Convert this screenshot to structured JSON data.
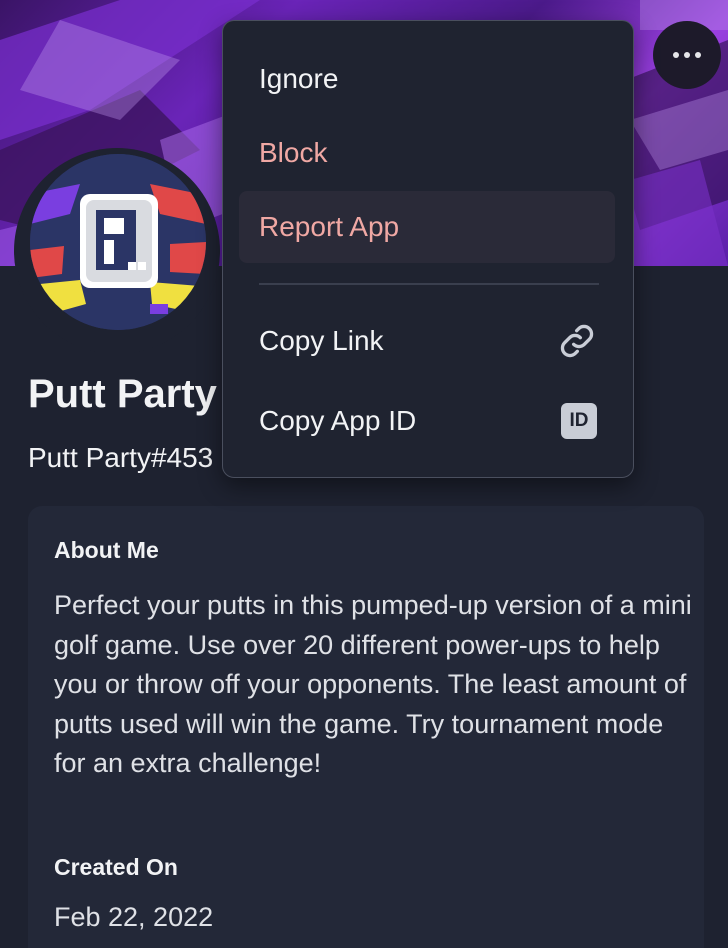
{
  "profile": {
    "name": "Putt Party",
    "tag": "Putt Party#453"
  },
  "about": {
    "title": "About Me",
    "text": "Perfect your putts in this pumped-up version of a mini golf game. Use over 20 different power-ups to help you or throw off your opponents. The least amount of putts used will win the game. Try tournament mode for an extra challenge!"
  },
  "created": {
    "title": "Created On",
    "value": "Feb 22, 2022"
  },
  "menu": {
    "items": [
      {
        "label": "Ignore",
        "style": "normal"
      },
      {
        "label": "Block",
        "style": "danger"
      },
      {
        "label": "Report App",
        "style": "danger",
        "highlighted": true
      },
      {
        "label": "Copy Link",
        "style": "normal",
        "icon": "link-icon"
      },
      {
        "label": "Copy App ID",
        "style": "normal",
        "icon": "id-icon",
        "badge": "ID"
      }
    ]
  },
  "icons": {
    "more": "more-options-icon",
    "link": "link-icon",
    "id": "id-icon"
  },
  "colors": {
    "background": "#1e2230",
    "card": "#232838",
    "menu": "#1f2330",
    "danger": "#f0a8a4",
    "banner": "#6a24b8"
  }
}
